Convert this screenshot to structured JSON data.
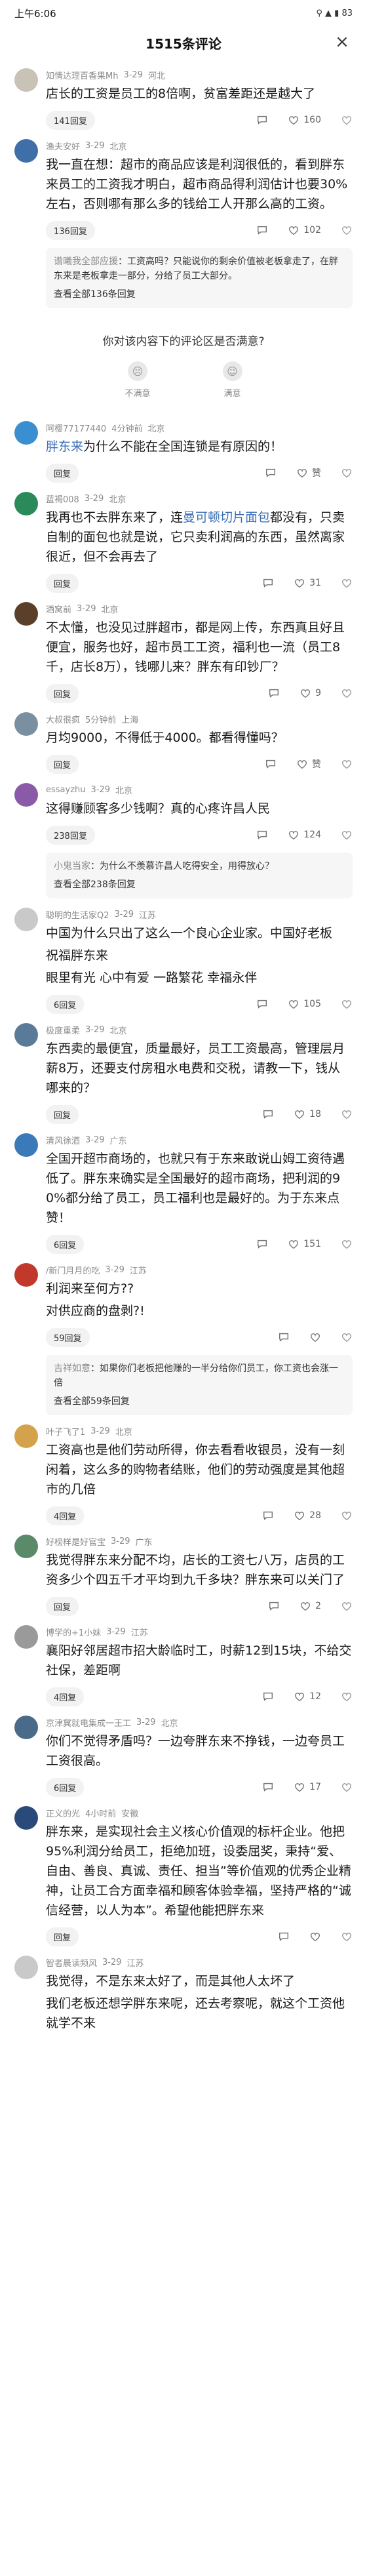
{
  "status_bar": {
    "time": "上午6:06",
    "icons": "⊠ ⊠ ◉ ⊠",
    "right": "⚲ ▲ ▮ 83"
  },
  "sheet": {
    "title": "1515条评论",
    "close": "×"
  },
  "comments": [
    {
      "nick": "知情达理百香果Mh",
      "time": "3-29",
      "loc": "河北",
      "text": "店长的工资是员工的8倍啊，贫富差距还是越大了",
      "reply_label": "141回复",
      "likes": "160",
      "avatar_color": "#c9c2b6"
    },
    {
      "nick": "渔夫安好",
      "time": "3-29",
      "loc": "北京",
      "text": "我一直在想：超市的商品应该是利润很低的，看到胖东来员工的工资我才明白，超市商品得利润估计也要30%左右，否则哪有那么多的钱给工人开那么高的工资。",
      "reply_label": "136回复",
      "likes": "102",
      "avatar_color": "#3f6fa8",
      "sub_reply": {
        "name": "谱曦我全部应援",
        "text": "工资高吗？只能说你的剩余价值被老板拿走了，在胖东来是老板拿走一部分，分给了员工大部分。",
        "more": "查看全部136条回复"
      }
    }
  ],
  "survey": {
    "question": "你对该内容下的评论区是否满意?",
    "opt_no": "不满意",
    "opt_yes": "满意"
  },
  "comments2": [
    {
      "nick": "阿樱77177440",
      "time": "4分钟前",
      "loc": "北京",
      "pre": "胖东来",
      "text": "为什么不能在全国连锁是有原因的！",
      "reply_label": "回复",
      "likes": "赞",
      "avatar_color": "#3a8fd0",
      "blue": true
    },
    {
      "nick": "蓝褐008",
      "time": "3-29",
      "loc": "北京",
      "text_a": "我再也不去胖东来了，连",
      "link": "曼可顿切片面包",
      "text_b": "都没有，只卖自制的面包",
      "text_c": "也就是说，它只卖利润高的东西，虽然离家很近，但不会再去了",
      "reply_label": "回复",
      "likes": "31",
      "avatar_color": "#2a8a5a"
    },
    {
      "nick": "酒窝前",
      "time": "3-29",
      "loc": "北京",
      "text": "不太懂，也没见过胖超市，都是网上传，东西真且好且便宜，服务也好，超市员工工资，福利也一流（员工8千，店长8万），钱哪儿来？胖东有印钞厂？",
      "reply_label": "回复",
      "likes": "9",
      "avatar_color": "#5a3f2a"
    },
    {
      "nick": "大叔很疯",
      "time": "5分钟前",
      "loc": "上海",
      "text": "月均9000，不得低于4000。都看得懂吗？",
      "reply_label": "回复",
      "likes": "赞",
      "avatar_color": "#7a8fa0"
    },
    {
      "nick": "essayzhu",
      "time": "3-29",
      "loc": "北京",
      "text": "这得赚顾客多少钱啊？真的心疼许昌人民",
      "reply_label": "238回复",
      "likes": "124",
      "avatar_color": "#8a5aa8",
      "sub_reply": {
        "name": "小鬼当家",
        "text": "为什么不羡慕许昌人吃得安全，用得放心？",
        "more": "查看全部238条回复"
      }
    },
    {
      "nick": "聪明的生活家Q2",
      "time": "3-29",
      "loc": "江苏",
      "text": "中国为什么只出了这么一个良心企业家。中国好老板",
      "text2": "祝福胖东来",
      "text3": "眼里有光 心中有爱 一路繁花 幸福永伴",
      "reply_label": "6回复",
      "likes": "105",
      "avatar_color": "#c9c9c9"
    },
    {
      "nick": "极度重柔",
      "time": "3-29",
      "loc": "北京",
      "text": "东西卖的最便宜，质量最好，员工工资最高，管理层月薪8万，还要支付房租水电费和交税，请教一下，钱从哪来的？",
      "reply_label": "回复",
      "likes": "18",
      "avatar_color": "#5a7a9a"
    },
    {
      "nick": "清风徐酒",
      "time": "3-29",
      "loc": "广东",
      "text": "全国开超市商场的，也就只有于东来敢说山姆工资待遇低了。胖东来确实是全国最好的超市商场，把利润的90%都分给了员工，员工福利也是最好的。为于东来点赞！",
      "reply_label": "6回复",
      "likes": "151",
      "avatar_color": "#3a7ab8"
    },
    {
      "nick": "/新门月月的吃",
      "time": "3-29",
      "loc": "江苏",
      "text": "利润来至何方??",
      "text2": "对供应商的盘剥?!",
      "reply_label": "59回复",
      "likes": "",
      "avatar_color": "#c0392b",
      "sub_reply": {
        "name": "吉祥如意",
        "text": "如果你们老板把他赚的一半分给你们员工，你工资也会涨一倍",
        "more": "查看全部59条回复"
      }
    },
    {
      "nick": "叶子飞了1",
      "time": "3-29",
      "loc": "北京",
      "text": "工资高也是他们劳动所得，你去看看收银员，没有一刻闲着，这么多的购物者结账，他们的劳动强度是其他超市的几倍",
      "reply_label": "4回复",
      "likes": "28",
      "avatar_color": "#d4a24a"
    },
    {
      "nick": "好榜样是好官宝",
      "time": "3-29",
      "loc": "广东",
      "text": "我觉得胖东来分配不均，店长的工资七八万，店员的工资多少个四五千才平均到九千多块？胖东来可以关门了",
      "reply_label": "回复",
      "likes": "2",
      "avatar_color": "#5a8a6a"
    },
    {
      "nick": "博学的+1小妹",
      "time": "3-29",
      "loc": "江苏",
      "text": "襄阳好邻居超市招大龄临时工，时薪12到15块，不给交社保，差距啊",
      "reply_label": "4回复",
      "likes": "12",
      "avatar_color": "#9a9a9a"
    },
    {
      "nick": "京津冀就电集成一王工",
      "time": "3-29",
      "loc": "北京",
      "text": "你们不觉得矛盾吗？一边夸胖东来不挣钱，一边夸员工工资很高。",
      "reply_label": "6回复",
      "likes": "17",
      "avatar_color": "#4a6a8a"
    },
    {
      "nick": "正义的光",
      "time": "4小时前",
      "loc": "安徽",
      "text": "胖东来，是实现社会主义核心价值观的标杆企业。他把95%利润分给员工，拒绝加班，设委屈奖，秉持“爱、自由、善良、真诚、责任、担当”等价值观的优秀企业精神，让员工合方面幸福和顾客体验幸福，坚持严格的“诚信经营，以人为本”。希望他能把胖东来",
      "reply_label": "回复",
      "likes": "",
      "avatar_color": "#2a4a7a"
    },
    {
      "nick": "智者晨读频风",
      "time": "3-29",
      "loc": "江苏",
      "text": "我觉得，不是东来太好了，而是其他人太坏了",
      "text_more": "我们老板还想学胖东来呢，还去考察呢，就这个工资他就学不来",
      "reply_label": "",
      "likes": "",
      "avatar_color": "#c9c9c9"
    }
  ]
}
